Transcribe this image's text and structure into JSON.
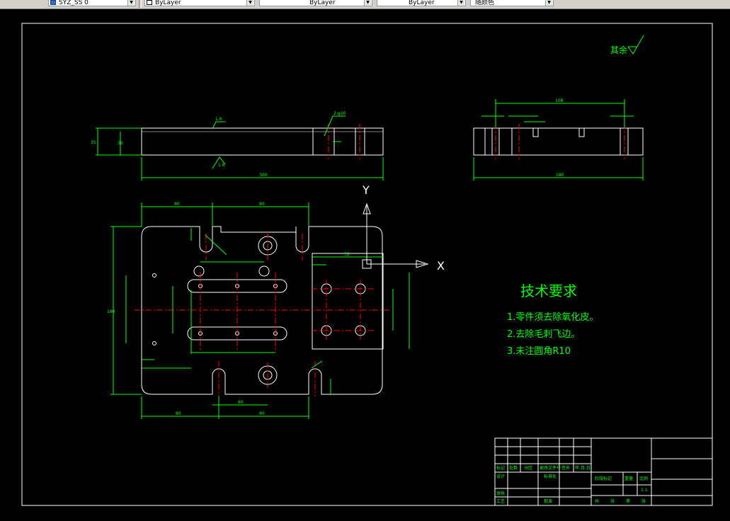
{
  "toolbar": {
    "combos": [
      {
        "value": "SYZ_SS 0",
        "icon": "layer-state-icon"
      },
      {
        "value": "ByLayer",
        "icon": "color-swatch-icon"
      },
      {
        "value": "ByLayer",
        "icon": "linetype-icon"
      },
      {
        "value": "ByLayer",
        "icon": "lineweight-icon"
      },
      {
        "value": "随颜色",
        "icon": "plotstyle-icon"
      }
    ]
  },
  "drawing": {
    "roughness_note": "其余",
    "axis_x": "X",
    "axis_y": "Y",
    "tech_title": "技术要求",
    "tech_items": [
      "1.零件须去除氧化皮。",
      "2.去除毛刺飞边。",
      "3.未注圆角R10"
    ],
    "dims": {
      "top_len": "300",
      "side_len": "180",
      "side_top": "108",
      "plan_w1": "80",
      "plan_w2": "80",
      "plan_h": "180",
      "plan_bottom1": "80",
      "plan_bottom2": "80",
      "plan_inner": "60",
      "sect_w": "32",
      "height_l": "35",
      "height_r": "30",
      "rough1": "1.6",
      "rough2": "1.6",
      "hole_note": "2-φ10"
    },
    "title_block": {
      "headers": [
        "标记",
        "处数",
        "分区",
        "更改文件号",
        "签名",
        "年.月.日"
      ],
      "rows": [
        "设计",
        "标准化",
        "审核",
        "工艺",
        "批准"
      ],
      "info": [
        "阶段标记",
        "重量",
        "比例",
        "1:1"
      ],
      "sheet": [
        "共",
        "张",
        "第",
        "张"
      ]
    }
  }
}
